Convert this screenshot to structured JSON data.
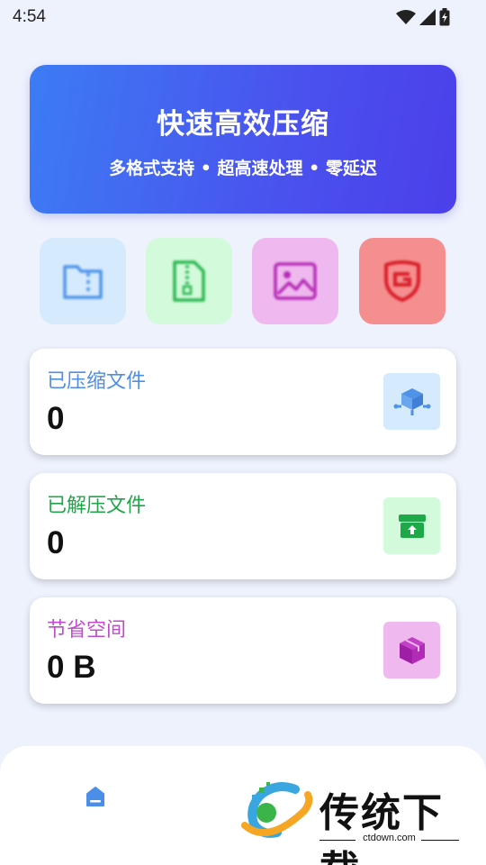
{
  "status_bar": {
    "time": "4:54",
    "icons": [
      "wifi-icon",
      "signal-icon",
      "battery-charging-icon"
    ]
  },
  "hero": {
    "title": "快速高效压缩",
    "subtitle": "多格式支持 • 超高速处理 • 零延迟"
  },
  "quick_actions": [
    {
      "icon": "folder-zip-icon",
      "bg": "#d6eafe",
      "color": "#4f93e8"
    },
    {
      "icon": "zip-file-icon",
      "bg": "#d3fadb",
      "color": "#29b84e"
    },
    {
      "icon": "image-icon",
      "bg": "#efb9ef",
      "color": "#b62bb6"
    },
    {
      "icon": "shield-icon",
      "bg": "#f58f8f",
      "color": "#d81e2a"
    }
  ],
  "stats": [
    {
      "label": "已压缩文件",
      "value": "0",
      "label_color": "#4f8ee3",
      "icon": "cube-network-icon",
      "icon_bg": "#d6eafe"
    },
    {
      "label": "已解压文件",
      "value": "0",
      "label_color": "#22a54a",
      "icon": "archive-box-icon",
      "icon_bg": "#d3fadb"
    },
    {
      "label": "节省空间",
      "value": "0 B",
      "label_color": "#c04ccd",
      "icon": "box-icon",
      "icon_bg": "#efb9ef"
    }
  ],
  "bottom_nav": {
    "home_icon": "home-icon",
    "accent": "#4a8ee8"
  },
  "watermark": {
    "text": "传统下载",
    "url": "ctdown.com"
  }
}
